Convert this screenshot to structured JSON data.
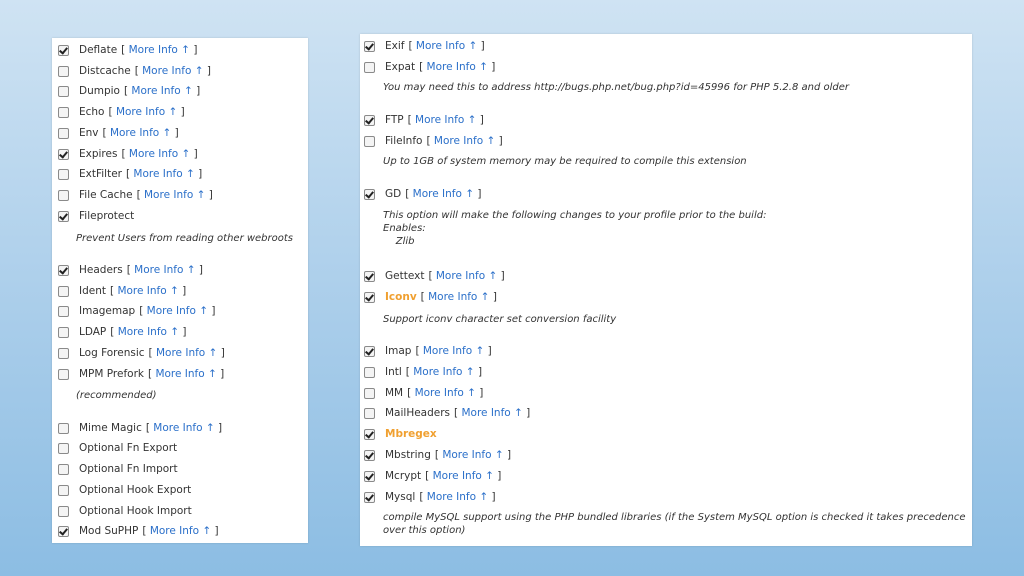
{
  "more_info": "More Info ↑",
  "left_options": [
    {
      "label": "Deflate",
      "checked": true,
      "info": true
    },
    {
      "label": "Distcache",
      "checked": false,
      "info": true
    },
    {
      "label": "Dumpio",
      "checked": false,
      "info": true
    },
    {
      "label": "Echo",
      "checked": false,
      "info": true
    },
    {
      "label": "Env",
      "checked": false,
      "info": true
    },
    {
      "label": "Expires",
      "checked": true,
      "info": true
    },
    {
      "label": "ExtFilter",
      "checked": false,
      "info": true
    },
    {
      "label": "File Cache",
      "checked": false,
      "info": true
    },
    {
      "label": "Fileprotect",
      "checked": true,
      "info": false,
      "note": "Prevent Users from reading other webroots"
    },
    {
      "label": "Headers",
      "checked": true,
      "info": true
    },
    {
      "label": "Ident",
      "checked": false,
      "info": true
    },
    {
      "label": "Imagemap",
      "checked": false,
      "info": true
    },
    {
      "label": "LDAP",
      "checked": false,
      "info": true
    },
    {
      "label": "Log Forensic",
      "checked": false,
      "info": true
    },
    {
      "label": "MPM Prefork",
      "checked": false,
      "info": true,
      "note": "(recommended)"
    },
    {
      "label": "Mime Magic",
      "checked": false,
      "info": true
    },
    {
      "label": "Optional Fn Export",
      "checked": false,
      "info": false
    },
    {
      "label": "Optional Fn Import",
      "checked": false,
      "info": false
    },
    {
      "label": "Optional Hook Export",
      "checked": false,
      "info": false
    },
    {
      "label": "Optional Hook Import",
      "checked": false,
      "info": false
    },
    {
      "label": "Mod SuPHP",
      "checked": true,
      "info": true
    }
  ],
  "right_options": [
    {
      "label": "Exif",
      "checked": true,
      "info": true
    },
    {
      "label": "Expat",
      "checked": false,
      "info": true,
      "note": "You may need this to address http://bugs.php.net/bug.php?id=45996 for PHP 5.2.8 and older"
    },
    {
      "label": "FTP",
      "checked": true,
      "info": true
    },
    {
      "label": "FileInfo",
      "checked": false,
      "info": true,
      "note": "Up to 1GB of system memory may be required to compile this extension"
    },
    {
      "label": "GD",
      "checked": true,
      "info": true,
      "note": "This option will make the following changes to your profile prior to the build:\nEnables:\n    Zlib"
    },
    {
      "label": "Gettext",
      "checked": true,
      "info": true
    },
    {
      "label": "Iconv",
      "checked": true,
      "info": true,
      "highlight": true,
      "note": "Support iconv character set conversion facility"
    },
    {
      "label": "Imap",
      "checked": true,
      "info": true
    },
    {
      "label": "Intl",
      "checked": false,
      "info": true
    },
    {
      "label": "MM",
      "checked": false,
      "info": true
    },
    {
      "label": "MailHeaders",
      "checked": false,
      "info": true
    },
    {
      "label": "Mbregex",
      "checked": true,
      "info": false,
      "highlight": true
    },
    {
      "label": "Mbstring",
      "checked": true,
      "info": true
    },
    {
      "label": "Mcrypt",
      "checked": true,
      "info": true
    },
    {
      "label": "Mysql",
      "checked": true,
      "info": true,
      "note": "compile MySQL support using the PHP bundled libraries (if the System MySQL option is checked it takes precedence\nover this option)"
    }
  ]
}
